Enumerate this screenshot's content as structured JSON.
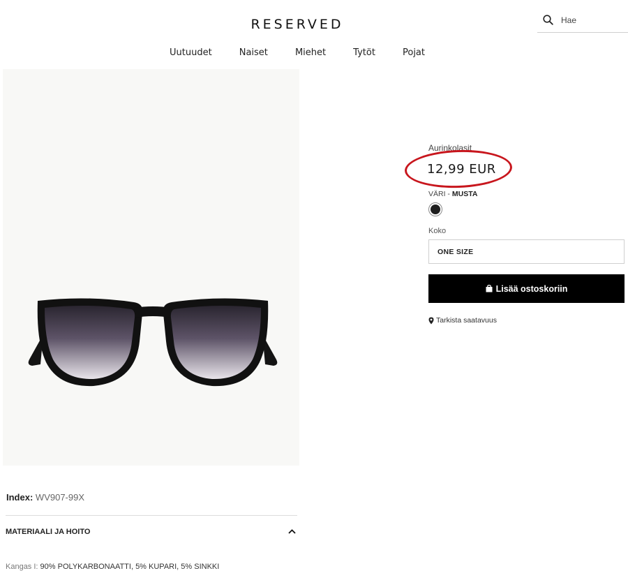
{
  "header": {
    "logo": "RESERVED",
    "search_placeholder": "Hae",
    "nav": [
      "Uutuudet",
      "Naiset",
      "Miehet",
      "Tytöt",
      "Pojat"
    ]
  },
  "product": {
    "category": "Aurinkolasit",
    "price": "12,99 EUR",
    "color_label": "VÄRI",
    "color_value": "MUSTA",
    "size_label": "Koko",
    "size_value": "ONE SIZE",
    "add_to_cart": "Lisää ostoskoriin",
    "check_availability": "Tarkista saatavuus",
    "index_label": "Index:",
    "index_value": "WV907-99X",
    "section_title": "MATERIAALI JA HOITO",
    "material_label": "Kangas I:",
    "material_value": "90% POLYKARBONAATTI, 5% KUPARI, 5% SINKKI"
  },
  "icons": {
    "search": "search-icon",
    "bag": "shopping-bag-icon",
    "pin": "location-pin-icon",
    "chevron": "chevron-up-icon"
  },
  "colors": {
    "price_highlight": "#c8161d",
    "button_bg": "#000000",
    "swatch": "#1e1e1e"
  }
}
